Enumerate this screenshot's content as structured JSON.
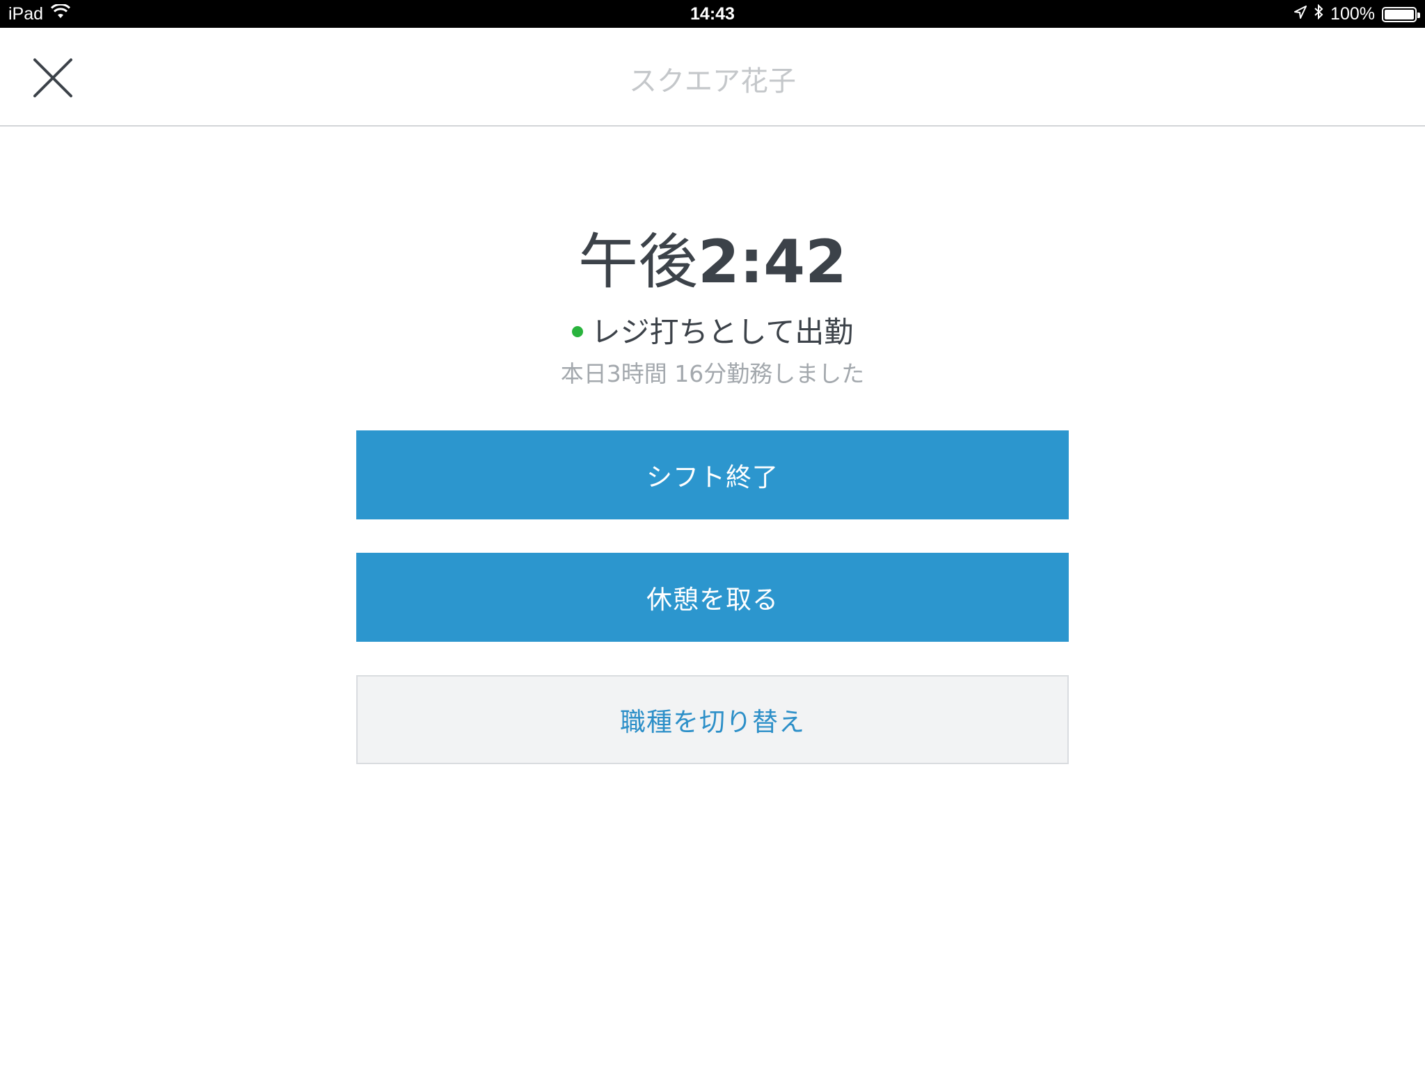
{
  "status_bar": {
    "device": "iPad",
    "time": "14:43",
    "battery_text": "100%",
    "battery_level": 1.0
  },
  "nav": {
    "title": "スクエア花子",
    "close_icon": "close-icon"
  },
  "main": {
    "time_period": "午後",
    "time_clock": "2:42",
    "status_text": "レジ打ちとして出勤",
    "status_color": "#29b33d",
    "worked_text": "本日3時間 16分勤務しました"
  },
  "actions": {
    "end_shift_label": "シフト終了",
    "take_break_label": "休憩を取る",
    "switch_job_label": "職種を切り替え"
  },
  "colors": {
    "primary": "#2c96ce",
    "secondary_bg": "#f2f3f4",
    "secondary_text": "#2c8fc8"
  }
}
